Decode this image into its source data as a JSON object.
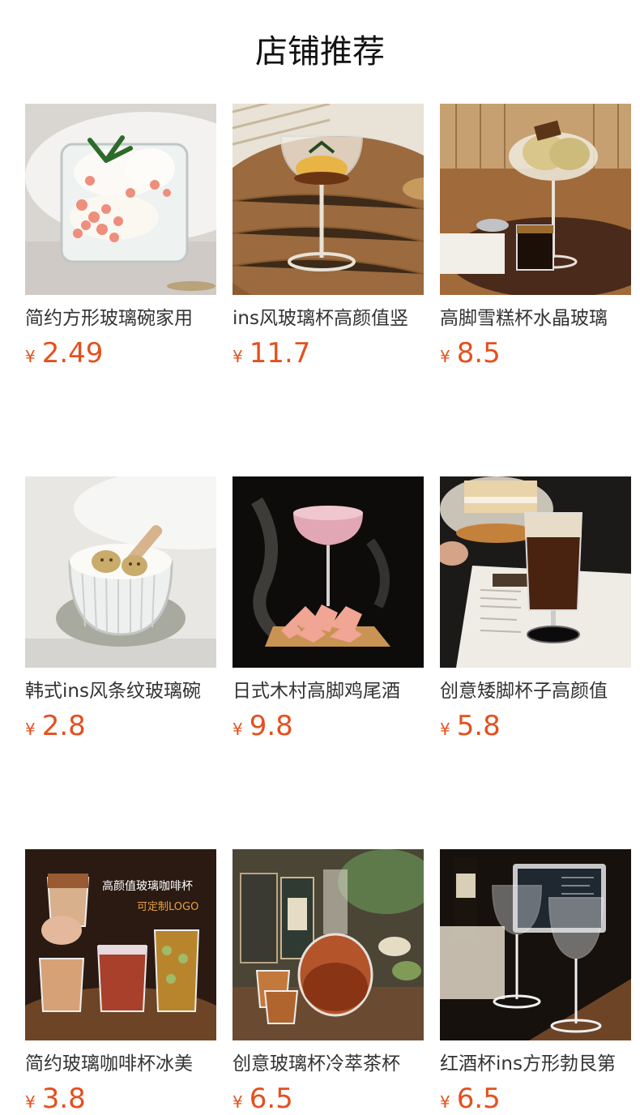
{
  "header": {
    "title": "店铺推荐"
  },
  "colors": {
    "price": "#e4501e"
  },
  "products": [
    {
      "name": "简约方形玻璃碗家用",
      "currency": "¥",
      "price": "2.49",
      "image": "square-glass-bowl-dessert"
    },
    {
      "name": "ins风玻璃杯高颜值竖",
      "currency": "¥",
      "price": "11.7",
      "image": "coupe-glass-pudding"
    },
    {
      "name": "高脚雪糕杯水晶玻璃",
      "currency": "¥",
      "price": "8.5",
      "image": "ice-cream-sundae-cup"
    },
    {
      "name": "韩式ins风条纹玻璃碗",
      "currency": "¥",
      "price": "2.8",
      "image": "ribbed-glass-bowl-yogurt"
    },
    {
      "name": "日式木村高脚鸡尾酒",
      "currency": "¥",
      "price": "9.8",
      "image": "smoking-cocktail-glass"
    },
    {
      "name": "创意矮脚杯子高颜值",
      "currency": "¥",
      "price": "5.8",
      "image": "short-stem-beer-glass"
    },
    {
      "name": "简约玻璃咖啡杯冰美",
      "currency": "¥",
      "price": "3.8",
      "image": "coffee-glasses-set",
      "overlay_line1": "高颜值玻璃咖啡杯",
      "overlay_line2": "可定制LOGO"
    },
    {
      "name": "创意玻璃杯冷萃茶杯",
      "currency": "¥",
      "price": "6.5",
      "image": "cold-brew-tea-pitcher"
    },
    {
      "name": "红酒杯ins方形勃艮第",
      "currency": "¥",
      "price": "6.5",
      "image": "wine-glasses-pair"
    }
  ]
}
